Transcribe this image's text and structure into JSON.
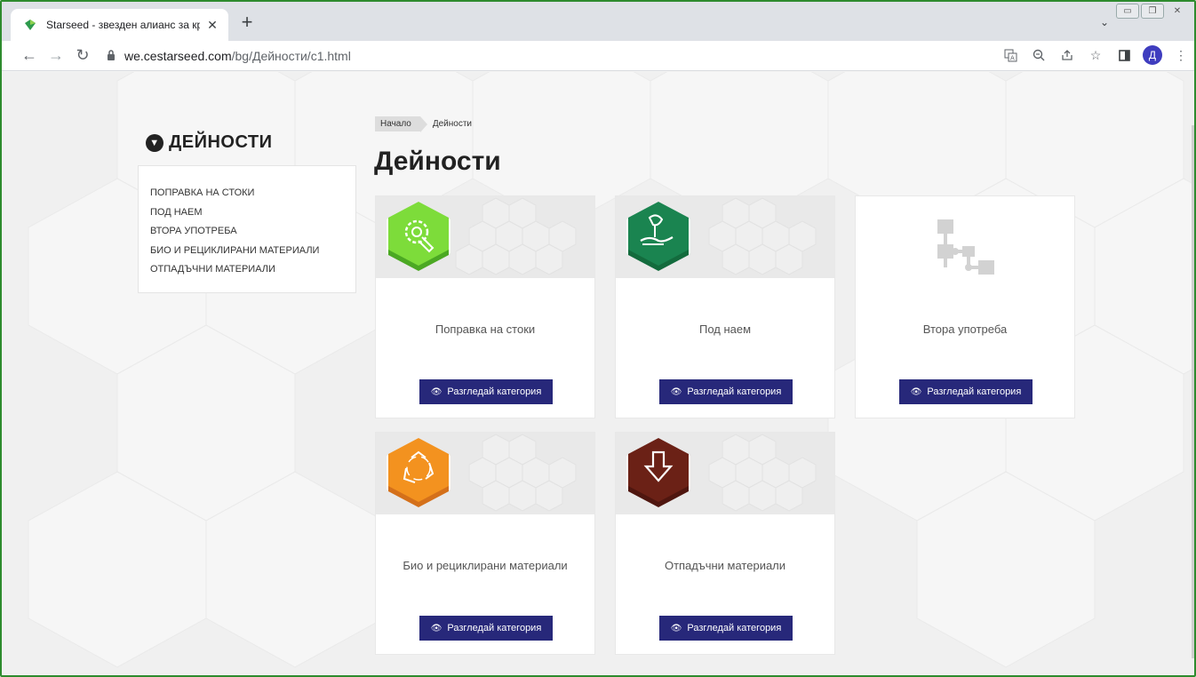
{
  "browser": {
    "tab_title": "Starseed - звезден алианс за кръг",
    "tab_close": "✕",
    "new_tab": "+",
    "url_host": "we.cestarseed.com",
    "url_path": "/bg/Дейности/c1.html",
    "avatar_letter": "Д"
  },
  "sidebar": {
    "title": "ДЕЙНОСТИ",
    "items": [
      "ПОПРАВКА НА СТОКИ",
      "ПОД НАЕМ",
      "ВТОРА УПОТРЕБА",
      "БИО И РЕЦИКЛИРАНИ МАТЕРИАЛИ",
      "ОТПАДЪЧНИ МАТЕРИАЛИ"
    ]
  },
  "breadcrumb": {
    "home": "Начало",
    "current": "Дейности"
  },
  "page_title": "Дейности",
  "cards": [
    {
      "name": "Поправка на стоки",
      "button": "Разгледай категория",
      "icon": "repair-gear-icon",
      "color": "#6fcf2f"
    },
    {
      "name": "Под наем",
      "button": "Разгледай категория",
      "icon": "rent-hand-icon",
      "color": "#1a7f4b"
    },
    {
      "name": "Втора употреба",
      "button": "Разгледай категория",
      "icon": "flowchart-icon",
      "color": "#cfcfcf"
    },
    {
      "name": "Био и рециклирани материали",
      "button": "Разгледай категория",
      "icon": "recycle-icon",
      "color": "#f18a1c"
    },
    {
      "name": "Отпадъчни материали",
      "button": "Разгледай категория",
      "icon": "download-arrow-icon",
      "color": "#6b2116"
    }
  ],
  "colors": {
    "button": "#27287a",
    "window_border": "#2e8b2e"
  }
}
